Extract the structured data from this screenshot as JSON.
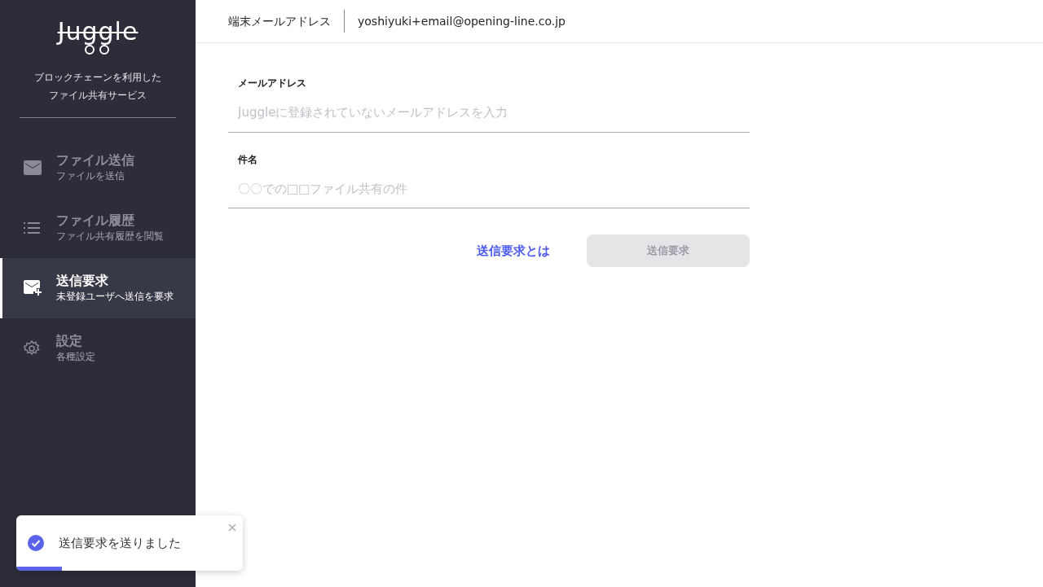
{
  "sidebar": {
    "logo": "Juggle",
    "tagline": [
      "ブロックチェーンを利用した",
      "ファイル共有サービス"
    ],
    "items": [
      {
        "kind": "mail",
        "title": "ファイル送信",
        "subtitle": "ファイルを送信",
        "selected": false
      },
      {
        "kind": "list",
        "title": "ファイル履歴",
        "subtitle": "ファイル共有履歴を閲覧",
        "selected": false
      },
      {
        "kind": "mail-plus",
        "title": "送信要求",
        "subtitle": "未登録ユーザへ送信を要求",
        "selected": true
      },
      {
        "kind": "gear",
        "title": "設定",
        "subtitle": "各種設定",
        "selected": false
      }
    ]
  },
  "header": {
    "label": "端末メールアドレス",
    "value": "yoshiyuki+email@opening-line.co.jp"
  },
  "form": {
    "fields": [
      {
        "label": "メールアドレス",
        "placeholder": "Juggleに登録されていないメールアドレスを入力"
      },
      {
        "label": "件名",
        "placeholder": "〇〇での□□ファイル共有の件"
      }
    ],
    "help_link": "送信要求とは",
    "submit": {
      "label": "送信要求",
      "disabled": true
    }
  },
  "toast": {
    "message": "送信要求を送りました",
    "level": 0.2
  }
}
